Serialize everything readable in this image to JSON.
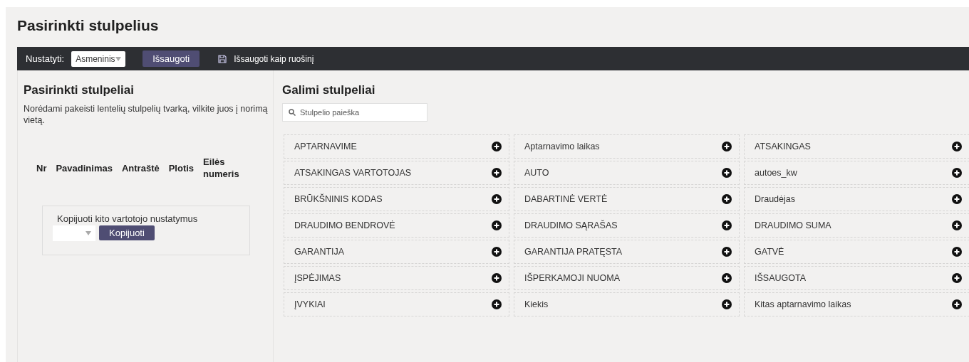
{
  "title": "Pasirinkti stulpelius",
  "toolbar": {
    "label": "Nustatyti:",
    "select": {
      "value": "Asmeninis"
    },
    "save_button": "Išsaugoti",
    "save_as_link": "Išsaugoti kaip ruošinį"
  },
  "selected_panel": {
    "heading": "Pasirinkti stulpeliai",
    "hint": "Norėdami pakeisti lentelių stulpelių tvarką, vilkite juos į norimą vietą.",
    "columns": [
      "Nr",
      "Pavadinimas",
      "Antraštė",
      "Plotis",
      "Eilės numeris"
    ],
    "copy_box": {
      "label": "Kopijuoti kito vartotojo nustatymus",
      "button": "Kopijuoti"
    }
  },
  "available_panel": {
    "heading": "Galimi stulpeliai",
    "search": {
      "placeholder": "Stulpelio paieška"
    },
    "items": [
      "APTARNAVIME",
      "Aptarnavimo laikas",
      "ATSAKINGAS",
      "ATSAKINGAS VARTOTOJAS",
      "AUTO",
      "autoes_kw",
      "BRŪKŠNINIS KODAS",
      "DABARTINĖ VERTĖ",
      "Draudėjas",
      "DRAUDIMO BENDROVĖ",
      "DRAUDIMO SĄRAŠAS",
      "DRAUDIMO SUMA",
      "GARANTIJA",
      "GARANTIJA PRATĘSTA",
      "GATVĖ",
      "ĮSPĖJIMAS",
      "IŠPERKAMOJI NUOMA",
      "IŠSAUGOTA",
      "ĮVYKIAI",
      "Kiekis",
      "Kitas aptarnavimo laikas"
    ]
  }
}
